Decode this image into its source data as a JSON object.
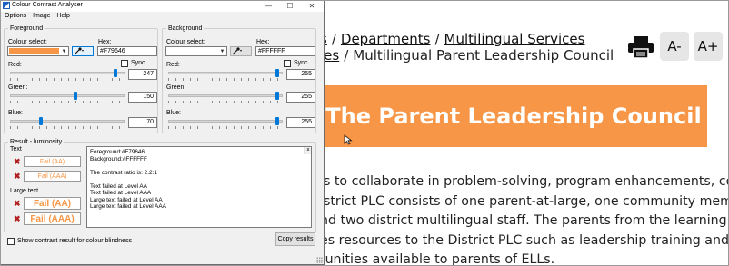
{
  "web": {
    "breadcrumb_line1": [
      "s",
      "Departments",
      "Multilingual Services"
    ],
    "breadcrumb_line2": [
      "ies",
      "Multilingual Parent Leadership Council"
    ],
    "zoom_out_label": "A-",
    "zoom_in_label": "A+",
    "banner_title": "The Parent Leadership Council",
    "banner_color": "#f79646",
    "body_lines": [
      "is to collaborate in problem-solving, program enhancements, communica",
      "istrict PLC consists of one parent-at-large, one community member, an El",
      "nd two district multilingual staff. The parents from the learning communi",
      "es resources to the District PLC such as leadership training and orientatio",
      "tunities available to parents of ELLs."
    ]
  },
  "cca": {
    "title": "Colour Contrast Analyser",
    "menu": [
      "Options",
      "Image",
      "Help"
    ],
    "foreground": {
      "group_label": "Foreground",
      "colour_select_label": "Colour select:",
      "hex_label": "Hex:",
      "hex_value": "#F79646",
      "swatch": "#f79646",
      "sync_label": "Sync",
      "red_label": "Red:",
      "red": "247",
      "green_label": "Green:",
      "green": "150",
      "blue_label": "Blue:",
      "blue": "70"
    },
    "background": {
      "group_label": "Background",
      "colour_select_label": "Colour select:",
      "hex_label": "Hex:",
      "hex_value": "#FFFFFF",
      "swatch": "#ffffff",
      "sync_label": "Sync",
      "red_label": "Red:",
      "red": "255",
      "green_label": "Green:",
      "green": "255",
      "blue_label": "Blue:",
      "blue": "255"
    },
    "result": {
      "group_label": "Result - luminosity",
      "text_label": "Text",
      "large_text_label": "Large text",
      "fail_aa": "Fail (AA)",
      "fail_aaa": "Fail (AAA)",
      "large_fail_aa": "Fail (AA)",
      "large_fail_aaa": "Fail (AAA)",
      "details": [
        "Foreground:#F79646",
        "Background:#FFFFFF",
        "",
        "The contrast ratio is: 2.2:1",
        "",
        "Text failed at Level AA",
        "Text failed at Level AAA",
        "Large text failed at Level AA",
        "Large text failed at Level AAA"
      ]
    },
    "colour_blindness_label": "Show contrast result for colour blindness",
    "copy_results_label": "Copy results"
  }
}
